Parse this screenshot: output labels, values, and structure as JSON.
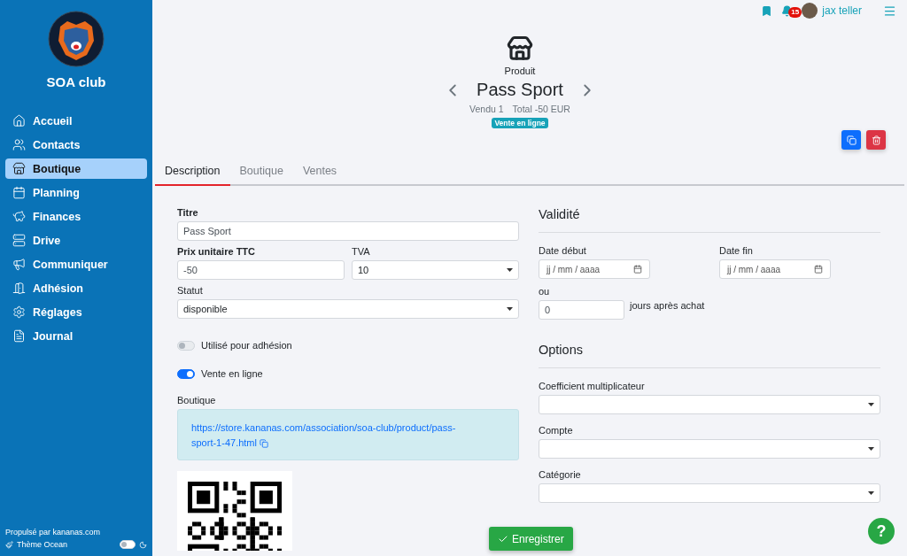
{
  "sidebar": {
    "club_name": "SOA club",
    "nav": [
      {
        "label": "Accueil",
        "selected": false
      },
      {
        "label": "Contacts",
        "selected": false
      },
      {
        "label": "Boutique",
        "selected": true
      },
      {
        "label": "Planning",
        "selected": false
      },
      {
        "label": "Finances",
        "selected": false
      },
      {
        "label": "Drive",
        "selected": false
      },
      {
        "label": "Communiquer",
        "selected": false
      },
      {
        "label": "Adhésion",
        "selected": false
      },
      {
        "label": "Réglages",
        "selected": false
      },
      {
        "label": "Journal",
        "selected": false
      }
    ],
    "powered_by": "Propulsé par kananas.com",
    "theme_label": "Thème Ocean",
    "dark_mode": false
  },
  "topbar": {
    "notification_count": "15",
    "user_name": "jax teller"
  },
  "header": {
    "kind_label": "Produit",
    "title": "Pass Sport",
    "stats": [
      "Vendu 1",
      "Total -50 EUR"
    ],
    "badge": "Vente en ligne"
  },
  "tabs": [
    {
      "label": "Description",
      "selected": true
    },
    {
      "label": "Boutique",
      "selected": false
    },
    {
      "label": "Ventes",
      "selected": false
    }
  ],
  "left": {
    "title": {
      "label": "Titre",
      "value": "Pass Sport"
    },
    "price": {
      "label": "Prix unitaire TTC",
      "value": "-50"
    },
    "vat": {
      "label": "TVA",
      "value": "10"
    },
    "status": {
      "label": "Statut",
      "value": "disponible"
    },
    "toggles": [
      {
        "label": "Utilisé pour adhésion",
        "on": false
      },
      {
        "label": "Vente en ligne",
        "on": true
      }
    ],
    "shop": {
      "label": "Boutique",
      "url": "https://store.kananas.com/association/soa-club/product/pass-sport-1-47.html"
    }
  },
  "right": {
    "validity": {
      "heading": "Validité",
      "start": {
        "label": "Date début",
        "placeholder": "jj / mm / aaaa"
      },
      "end": {
        "label": "Date fin",
        "placeholder": "jj / mm / aaaa"
      },
      "or_label": "ou",
      "days": {
        "value": "0",
        "suffix": "jours après achat"
      }
    },
    "options": {
      "heading": "Options",
      "selects": [
        {
          "label": "Coefficient multiplicateur"
        },
        {
          "label": "Compte"
        },
        {
          "label": "Catégorie"
        }
      ]
    }
  },
  "save_button": "Enregistrer",
  "help_button": "?"
}
